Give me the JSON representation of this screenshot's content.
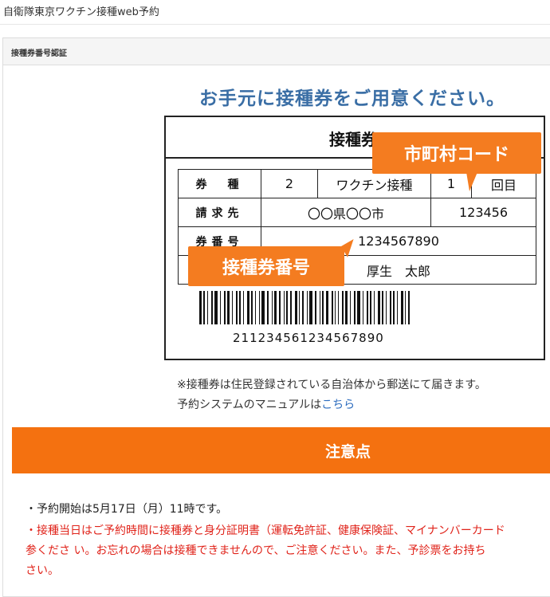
{
  "app": {
    "title": "自衛隊東京ワクチン接種web予約"
  },
  "panel": {
    "title": "接種券番号認証"
  },
  "headline": "お手元に接種券をご用意ください。",
  "ticket": {
    "title": "接種券",
    "row1": {
      "label": "券　種",
      "type_value": "2",
      "vaccine_label": "ワクチン接種",
      "count_value": "1",
      "count_suffix": "回目"
    },
    "row2": {
      "label": "請求先",
      "value": "〇〇県〇〇市",
      "municipal_code": "123456"
    },
    "row3": {
      "label": "券番号",
      "value": "1234567890"
    },
    "row4": {
      "name": "厚生　太郎"
    },
    "barcode_number": "211234561234567890"
  },
  "callouts": {
    "municipal_code": "市町村コード",
    "ticket_number": "接種券番号"
  },
  "notes": {
    "mail_note": "※接種券は住民登録されている自治体から郵送にて届きます。",
    "manual_prefix": "予約システムのマニュアルは",
    "manual_link": "こちら"
  },
  "banner": {
    "title": "注意点"
  },
  "cautions": [
    "・予約開始は5月17日（月）11時です。",
    "・接種当日はご予約時間に接種券と身分証明書（運転免許証、健康保険証、マイナンバーカード",
    "参くださ い。お忘れの場合は接種できませんので、ご注意ください。また、予診票をお持ち",
    "さい。"
  ],
  "colors": {
    "accent": "#f47110",
    "headline": "#3a6ea5",
    "warning": "#e0231a",
    "link": "#2f6ebf"
  }
}
